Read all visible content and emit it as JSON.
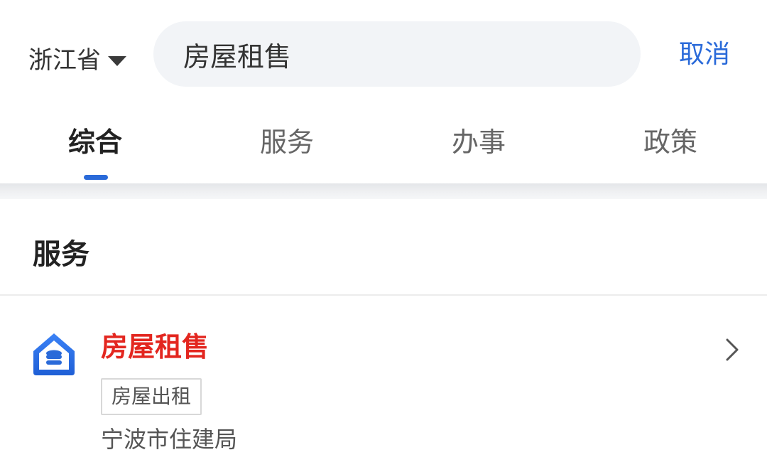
{
  "header": {
    "region": "浙江省",
    "search": {
      "value": "房屋租售",
      "placeholder": ""
    },
    "cancel_label": "取消"
  },
  "tabs": [
    {
      "label": "综合",
      "active": true
    },
    {
      "label": "服务",
      "active": false
    },
    {
      "label": "办事",
      "active": false
    },
    {
      "label": "政策",
      "active": false
    }
  ],
  "section": {
    "title": "服务"
  },
  "results": [
    {
      "icon": "house-database-icon",
      "title": "房屋租售",
      "tag": "房屋出租",
      "department": "宁波市住建局"
    }
  ],
  "colors": {
    "accent": "#2a6ad9",
    "highlight": "#e3261f",
    "search_bg": "#f2f4f7"
  }
}
